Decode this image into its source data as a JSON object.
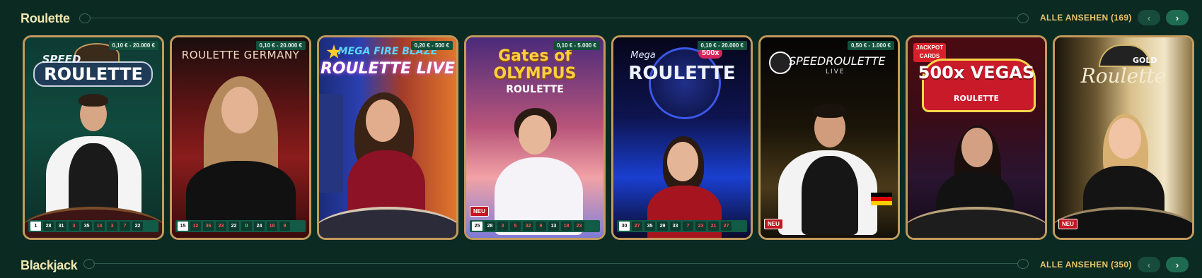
{
  "sections": [
    {
      "title": "Roulette",
      "view_all": "ALLE ANSEHEN (169)"
    },
    {
      "title": "Blackjack",
      "view_all": "ALLE ANSEHEN (350)"
    }
  ],
  "icons": {
    "prev": "chevron-left-icon",
    "next": "chevron-right-icon"
  },
  "glyphs": {
    "prev": "‹",
    "next": "›"
  },
  "colors": {
    "background": "#0b2a22",
    "accent_gold": "#e9c46a",
    "card_border": "#c39a5d",
    "results_bar": "#125b46",
    "new_badge": "#c21722"
  },
  "cards": [
    {
      "logo_line1": "SPEED",
      "logo_line2": "ROULETTE",
      "stake": "0,10 € - 20.000 €",
      "badge": "",
      "results": [
        {
          "n": "1",
          "c": "w"
        },
        {
          "n": "28",
          "c": "b"
        },
        {
          "n": "31",
          "c": "b"
        },
        {
          "n": "3",
          "c": "r"
        },
        {
          "n": "35",
          "c": "b"
        },
        {
          "n": "14",
          "c": "r"
        },
        {
          "n": "3",
          "c": "r"
        },
        {
          "n": "7",
          "c": "r"
        },
        {
          "n": "22",
          "c": "b"
        }
      ]
    },
    {
      "logo_line1": "ROULETTE GERMANY",
      "logo_line2": "",
      "stake": "0,10 € - 20.000 €",
      "badge": "",
      "results": [
        {
          "n": "15",
          "c": "w"
        },
        {
          "n": "12",
          "c": "r"
        },
        {
          "n": "36",
          "c": "r"
        },
        {
          "n": "23",
          "c": "r"
        },
        {
          "n": "22",
          "c": "b"
        },
        {
          "n": "0",
          "c": "g"
        },
        {
          "n": "24",
          "c": "b"
        },
        {
          "n": "18",
          "c": "r"
        },
        {
          "n": "9",
          "c": "r"
        }
      ]
    },
    {
      "logo_line1": "MEGA FIRE BLAZE",
      "logo_line2": "ROULETTE LIVE",
      "stake": "0,20 € - 500 €",
      "badge": "",
      "results": []
    },
    {
      "logo_line1": "Gates of OLYMPUS",
      "logo_line2": "ROULETTE",
      "stake": "0,10 € - 5.000 €",
      "badge": "NEU",
      "results": [
        {
          "n": "25",
          "c": "w"
        },
        {
          "n": "28",
          "c": "b"
        },
        {
          "n": "3",
          "c": "r"
        },
        {
          "n": "5",
          "c": "r"
        },
        {
          "n": "32",
          "c": "r"
        },
        {
          "n": "9",
          "c": "r"
        },
        {
          "n": "13",
          "c": "b"
        },
        {
          "n": "18",
          "c": "r"
        },
        {
          "n": "23",
          "c": "r"
        }
      ]
    },
    {
      "logo_line1": "Mega",
      "logo_line2": "ROULETTE",
      "extra": "500x",
      "stake": "0,10 € - 20.000 €",
      "badge": "",
      "results": [
        {
          "n": "30",
          "c": "w"
        },
        {
          "n": "27",
          "c": "r"
        },
        {
          "n": "35",
          "c": "b"
        },
        {
          "n": "29",
          "c": "b"
        },
        {
          "n": "33",
          "c": "b"
        },
        {
          "n": "7",
          "c": "r"
        },
        {
          "n": "23",
          "c": "r"
        },
        {
          "n": "21",
          "c": "r"
        },
        {
          "n": "27",
          "c": "r"
        }
      ]
    },
    {
      "logo_line1": "SPEEDROULETTE",
      "logo_line2": "LIVE",
      "stake": "0,50 € - 1.000 €",
      "badge": "NEU",
      "results": []
    },
    {
      "logo_line1": "500x VEGAS",
      "logo_line2": "ROULETTE",
      "extra": "JACKPOT CARDS",
      "stake": "",
      "badge": "",
      "results": []
    },
    {
      "logo_line1": "GOLD",
      "logo_line2": "Roulette",
      "stake": "",
      "badge": "NEU",
      "results": []
    }
  ]
}
